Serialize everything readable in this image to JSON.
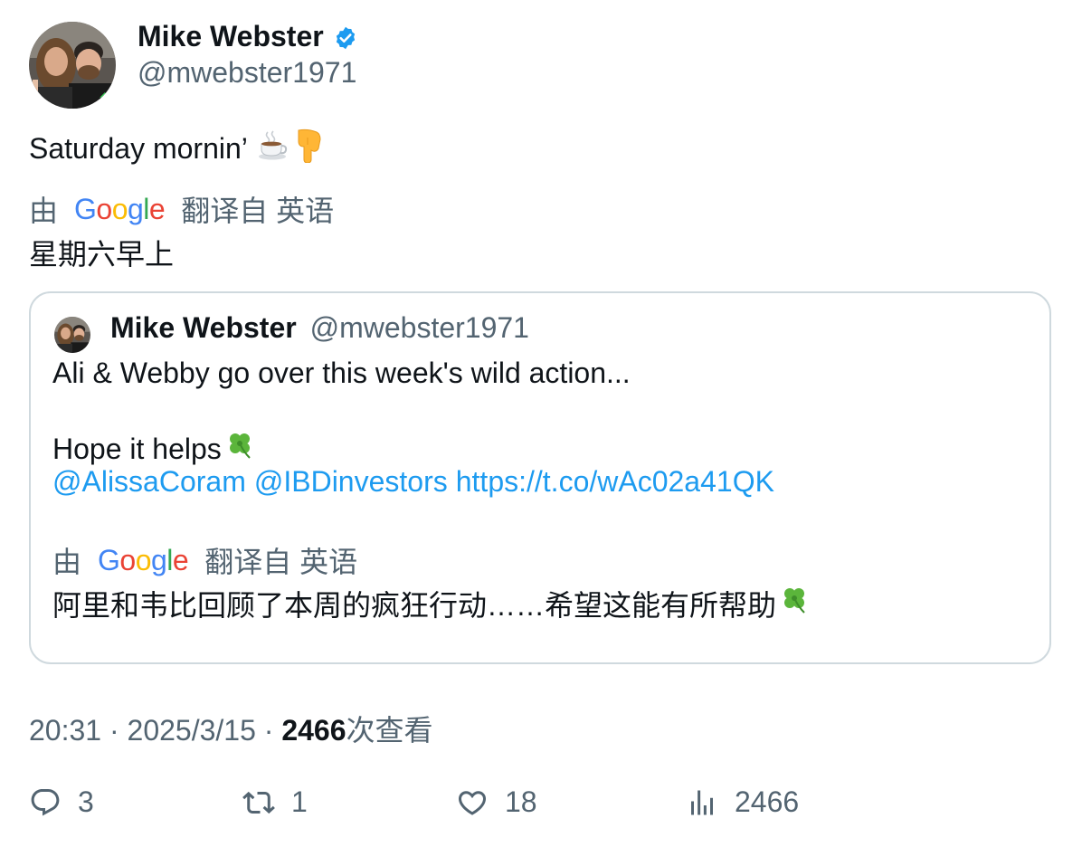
{
  "tweet": {
    "author": {
      "name": "Mike Webster",
      "handle": "@mwebster1971",
      "verified": true,
      "verified_color": "#1d9bf0"
    },
    "text": "Saturday mornin’",
    "text_emojis": [
      "coffee-cup",
      "backhand-index-pointing-down"
    ],
    "translation": {
      "prefix": "由",
      "provider_logo": "Google",
      "suffix": "翻译自 英语",
      "text": "星期六早上"
    },
    "quoted": {
      "author": {
        "name": "Mike Webster",
        "handle": "@mwebster1971"
      },
      "line1": "Ali & Webby go over this week's wild action...",
      "line2": "Hope it helps",
      "line2_emoji": "four-leaf-clover",
      "mention1": "@AlissaCoram",
      "mention2": "@IBDinvestors",
      "link": "https://t.co/wAc02a41QK",
      "translation": {
        "prefix": "由",
        "provider_logo": "Google",
        "suffix": "翻译自 英语",
        "text": "阿里和韦比回顾了本周的疯狂行动……希望这能有所帮助",
        "text_emoji": "four-leaf-clover"
      }
    },
    "meta": {
      "time": "20:31",
      "separator": "·",
      "date": "2025/3/15",
      "views_count": "2466",
      "views_label": "次查看"
    },
    "actions": {
      "replies": "3",
      "reposts": "1",
      "likes": "18",
      "views": "2466"
    }
  },
  "colors": {
    "text_primary": "#0f1419",
    "text_secondary": "#536471",
    "link": "#1d9bf0",
    "border": "#cfd9de"
  }
}
